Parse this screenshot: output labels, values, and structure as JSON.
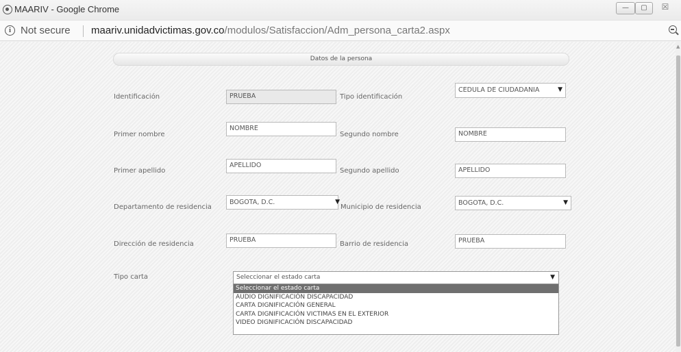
{
  "window": {
    "title": "MAARIV - Google Chrome",
    "minimize": "—",
    "maximize": "▢",
    "close": "☒"
  },
  "address_bar": {
    "security_text": "Not secure",
    "url_host": "maariv.unidadvictimas.gov.co",
    "url_path": "/modulos/Satisfaccion/Adm_persona_carta2.aspx"
  },
  "form": {
    "section_title": "Datos de la persona",
    "identificacion": {
      "label": "Identificación",
      "value": "PRUEBA"
    },
    "tipo_identificacion": {
      "label": "Tipo identificación",
      "value": "CEDULA DE CIUDADANIA"
    },
    "primer_nombre": {
      "label": "Primer nombre",
      "value": "NOMBRE"
    },
    "segundo_nombre": {
      "label": "Segundo nombre",
      "value": "NOMBRE"
    },
    "primer_apellido": {
      "label": "Primer apellido",
      "value": "APELLIDO"
    },
    "segundo_apellido": {
      "label": "Segundo apellido",
      "value": "APELLIDO"
    },
    "departamento": {
      "label": "Departamento de residencia",
      "value": "BOGOTA, D.C."
    },
    "municipio": {
      "label": "Municipio de residencia",
      "value": "BOGOTA, D.C."
    },
    "direccion": {
      "label": "Dirección de residencia",
      "value": "PRUEBA"
    },
    "barrio": {
      "label": "Barrio de residencia",
      "value": "PRUEBA"
    },
    "tipo_carta": {
      "label": "Tipo carta",
      "value": "Seleccionar el estado carta",
      "options": [
        "Seleccionar el estado carta",
        "AUDIO DIGNIFICACIÓN DISCAPACIDAD",
        "CARTA DIGNIFICACIÓN GENERAL",
        "CARTA DIGNIFICACIÓN VICTIMAS EN EL EXTERIOR",
        "VIDEO DIGNIFICACIÓN DISCAPACIDAD"
      ],
      "highlighted_option": "Seleccionar el estado carta"
    }
  },
  "icons": {
    "app": "chrome-app-icon",
    "info": "info-icon",
    "zoom": "zoom-out-icon",
    "dropdown_arrow": "▼"
  }
}
